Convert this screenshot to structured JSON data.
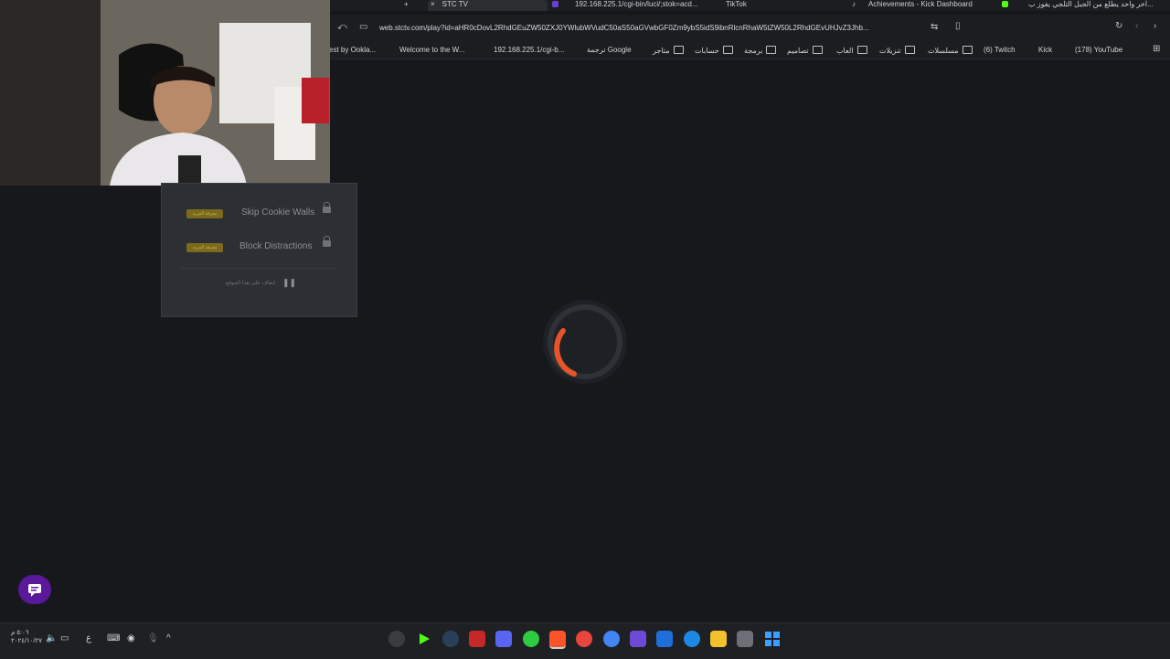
{
  "tabs": [
    {
      "label": "+",
      "color": "#cfd2d6"
    },
    {
      "label": "STC TV",
      "close": "×",
      "color": "#1b1d21"
    },
    {
      "label": "192.168.225.1/cgi-bin/luci/;stok=acd...",
      "color": "#6a3fd6"
    },
    {
      "label": "TikTok",
      "color": "#1b1d21"
    },
    {
      "label": "Achievements - Kick Dashboard",
      "color": "#53fc18"
    },
    {
      "label": "آخر واحد يطلع من الجبل الثلجي يفوز ب...",
      "color": "#e0242e"
    }
  ],
  "address": {
    "url": "web.stctv.com/play?id=aHR0cDovL2RhdGEuZW50ZXJ0YWlubWVudC50aS50aGVwbGF0Zm9ybS5idS9ibnRlcnRhaW5tZW50L2RhdGEvUHJvZ3Jhb..."
  },
  "bookmarks": [
    {
      "label": "est by Ookla..."
    },
    {
      "label": "Welcome to the W..."
    },
    {
      "label": "192.168.225.1/cgi-b..."
    },
    {
      "label": "ترجمة Google"
    },
    {
      "label": "متاجر"
    },
    {
      "label": "حسابات"
    },
    {
      "label": "برمجة"
    },
    {
      "label": "تصاميم"
    },
    {
      "label": "العاب"
    },
    {
      "label": "تنزيلات"
    },
    {
      "label": "مسلسلات"
    },
    {
      "label": "(6) Twitch"
    },
    {
      "label": "Kick"
    },
    {
      "label": "(178) YouTube"
    }
  ],
  "popup": {
    "rows": [
      {
        "badge": "معرفة المزيد",
        "label": "Skip Cookie Walls"
      },
      {
        "badge": "معرفة المزيد",
        "label": "Block Distractions"
      }
    ],
    "pause_label": "ايقاف على هذا الموقع"
  },
  "spinner": {
    "color": "#e8542a"
  },
  "taskbar": {
    "clock_time": "٥:٠٦ م",
    "clock_date": "٢٠٢٤/١٠/٢٧",
    "lang": "ع"
  }
}
